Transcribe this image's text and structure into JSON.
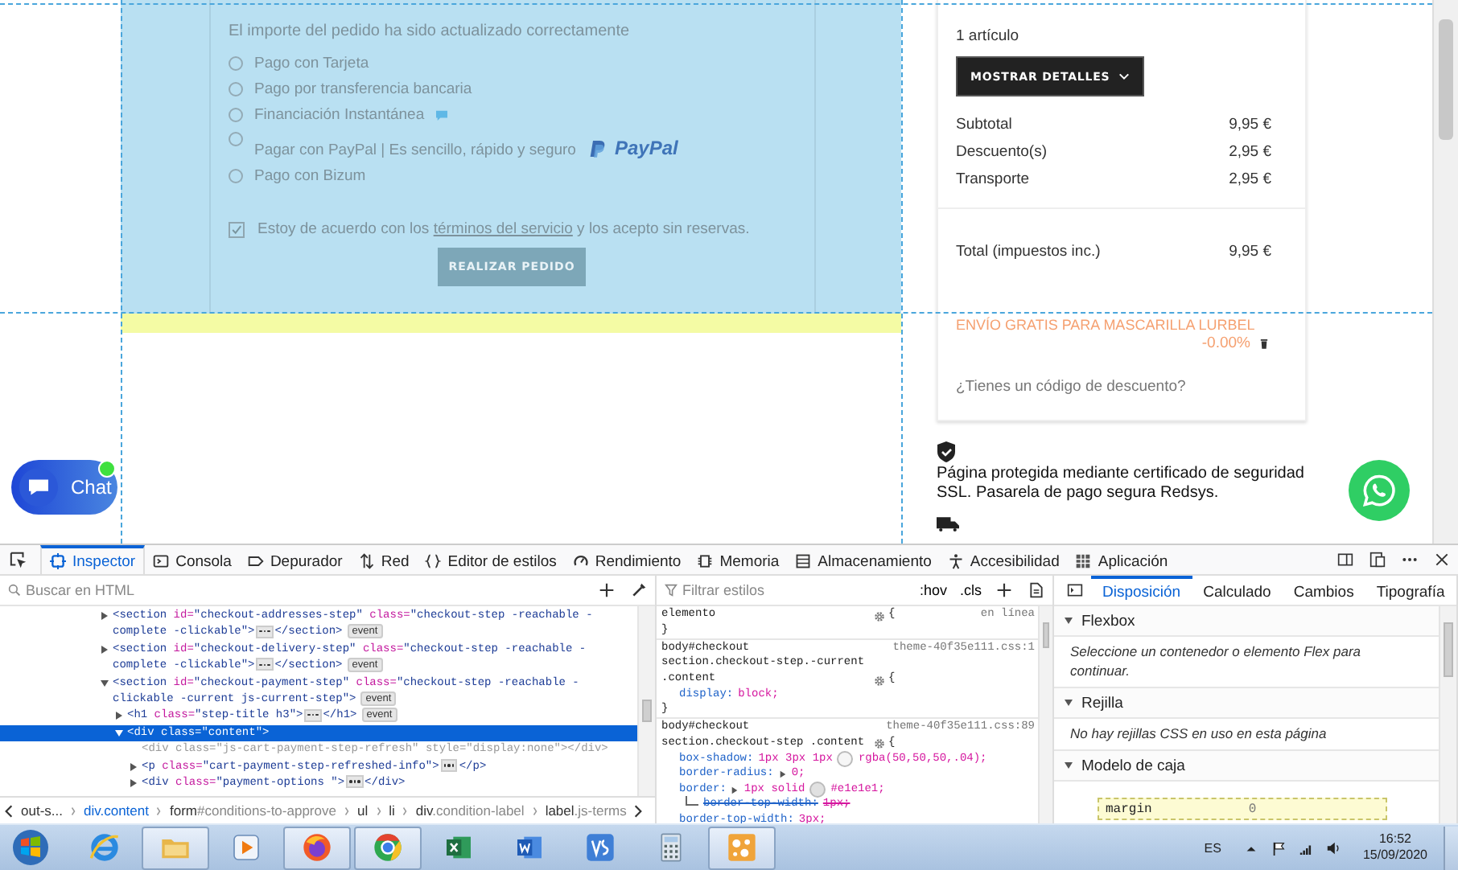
{
  "page": {
    "notice": "El importe del pedido ha sido actualizado correctamente",
    "payment_options": [
      {
        "label": "Pago con Tarjeta",
        "selected": false,
        "kind": "plain"
      },
      {
        "label": "Pago por transferencia bancaria",
        "selected": false,
        "kind": "plain"
      },
      {
        "label": "Financiación Instantánea",
        "selected": false,
        "kind": "info"
      },
      {
        "label": "Pagar con PayPal | Es sencillo, rápido y seguro",
        "selected": false,
        "kind": "logo",
        "logo": "PayPal"
      },
      {
        "label": "Pago con Bizum",
        "selected": false,
        "kind": "plain"
      }
    ],
    "terms": {
      "checked": true,
      "before": "Estoy de acuerdo con los ",
      "link": "términos del servicio",
      "after": " y los acepto sin reservas."
    },
    "order_button": "REALIZAR PEDIDO",
    "chat": {
      "label": "Chat",
      "online": true
    }
  },
  "order_summary": {
    "item_count": "1 artículo",
    "details_button": "MOSTRAR DETALLES",
    "lines": [
      {
        "label": "Subtotal",
        "value": "9,95 €"
      },
      {
        "label": "Descuento(s)",
        "value": "2,95 €"
      },
      {
        "label": "Transporte",
        "value": "2,95 €"
      }
    ],
    "total": {
      "label": "Total (impuestos inc.)",
      "value": "9,95 €"
    },
    "promo": {
      "name": "ENVÍO GRATIS PARA MASCARILLA LURBEL",
      "value": "-0.00%"
    },
    "discount_prompt": "¿Tienes un código de descuento?",
    "security_note": "Página protegida mediante certificado de seguridad SSL. Pasarela de pago segura Redsys."
  },
  "devtools": {
    "tabs": [
      {
        "label": "Inspector",
        "kind": "inspector",
        "selected": true
      },
      {
        "label": "Consola",
        "kind": "console",
        "selected": false
      },
      {
        "label": "Depurador",
        "kind": "debugger",
        "selected": false
      },
      {
        "label": "Red",
        "kind": "network",
        "selected": false
      },
      {
        "label": "Editor de estilos",
        "kind": "style",
        "selected": false
      },
      {
        "label": "Rendimiento",
        "kind": "performance",
        "selected": false
      },
      {
        "label": "Memoria",
        "kind": "memory",
        "selected": false
      },
      {
        "label": "Almacenamiento",
        "kind": "storage",
        "selected": false
      },
      {
        "label": "Accesibilidad",
        "kind": "accessibility",
        "selected": false
      },
      {
        "label": "Aplicación",
        "kind": "application",
        "selected": false
      }
    ],
    "search_placeholder": "Buscar en HTML",
    "tree": [
      {
        "selected": false,
        "expanded": false,
        "parts": [
          {
            "kind": "tag",
            "text": "<section"
          },
          {
            "kind": "attr",
            "text": " id="
          },
          {
            "kind": "value",
            "text": "\"checkout-addresses-step\""
          },
          {
            "kind": "attr",
            "text": " class="
          },
          {
            "kind": "value",
            "text": "\"checkout-step -reachable -complete -clickable\""
          },
          {
            "kind": "tag",
            "text": ">"
          },
          {
            "kind": "more"
          },
          {
            "kind": "tag",
            "text": "</section>"
          },
          {
            "kind": "badge",
            "text": "event"
          }
        ]
      },
      {
        "selected": false,
        "expanded": false,
        "parts": [
          {
            "kind": "tag",
            "text": "<section"
          },
          {
            "kind": "attr",
            "text": " id="
          },
          {
            "kind": "value",
            "text": "\"checkout-delivery-step\""
          },
          {
            "kind": "attr",
            "text": " class="
          },
          {
            "kind": "value",
            "text": "\"checkout-step -reachable -complete -clickable\""
          },
          {
            "kind": "tag",
            "text": ">"
          },
          {
            "kind": "more"
          },
          {
            "kind": "tag",
            "text": "</section>"
          },
          {
            "kind": "badge",
            "text": "event"
          }
        ]
      },
      {
        "selected": false,
        "expanded": true,
        "parts": [
          {
            "kind": "tag",
            "text": "<section"
          },
          {
            "kind": "attr",
            "text": " id="
          },
          {
            "kind": "value",
            "text": "\"checkout-payment-step\""
          },
          {
            "kind": "attr",
            "text": " class="
          },
          {
            "kind": "value",
            "text": "\"checkout-step -reachable -clickable -current js-current-step\""
          },
          {
            "kind": "tag",
            "text": ">"
          },
          {
            "kind": "badge",
            "text": "event"
          }
        ],
        "children": [
          {
            "selected": false,
            "expanded": false,
            "parts": [
              {
                "kind": "tag",
                "text": "<h1"
              },
              {
                "kind": "attr",
                "text": " class="
              },
              {
                "kind": "value",
                "text": "\"step-title h3\""
              },
              {
                "kind": "tag",
                "text": ">"
              },
              {
                "kind": "more"
              },
              {
                "kind": "tag",
                "text": "</h1>"
              },
              {
                "kind": "badge",
                "text": "event"
              }
            ]
          },
          {
            "selected": true,
            "expanded": true,
            "parts": [
              {
                "kind": "tag",
                "text": "<div"
              },
              {
                "kind": "attr",
                "text": " class="
              },
              {
                "kind": "value",
                "text": "\"content\""
              },
              {
                "kind": "tag",
                "text": ">"
              }
            ],
            "children": [
              {
                "selected": false,
                "hidden": true,
                "parts": [
                  {
                    "kind": "tag",
                    "text": "<div"
                  },
                  {
                    "kind": "attr",
                    "text": " class="
                  },
                  {
                    "kind": "value",
                    "text": "\"js-cart-payment-step-refresh\""
                  },
                  {
                    "kind": "attr",
                    "text": " style="
                  },
                  {
                    "kind": "value",
                    "text": "\"display:none\""
                  },
                  {
                    "kind": "tag",
                    "text": "></div>"
                  }
                ]
              },
              {
                "selected": false,
                "expanded": false,
                "parts": [
                  {
                    "kind": "tag",
                    "text": "<p"
                  },
                  {
                    "kind": "attr",
                    "text": " class="
                  },
                  {
                    "kind": "value",
                    "text": "\"cart-payment-step-refreshed-info\""
                  },
                  {
                    "kind": "tag",
                    "text": ">"
                  },
                  {
                    "kind": "more"
                  },
                  {
                    "kind": "tag",
                    "text": "</p>"
                  }
                ]
              },
              {
                "selected": false,
                "expanded": false,
                "parts": [
                  {
                    "kind": "tag",
                    "text": "<div"
                  },
                  {
                    "kind": "attr",
                    "text": " class="
                  },
                  {
                    "kind": "value",
                    "text": "\"payment-options \""
                  },
                  {
                    "kind": "tag",
                    "text": ">"
                  },
                  {
                    "kind": "more"
                  },
                  {
                    "kind": "tag",
                    "text": "</div>"
                  }
                ]
              }
            ]
          }
        ]
      }
    ],
    "breadcrumb": [
      {
        "tag": "out-s...",
        "selected": false
      },
      {
        "tag": "div",
        "rest": ".content",
        "selected": true
      },
      {
        "tag": "form",
        "rest": "#conditions-to-approve",
        "selected": false
      },
      {
        "tag": "ul",
        "selected": false
      },
      {
        "tag": "li",
        "selected": false
      },
      {
        "tag": "div",
        "rest": ".condition-label",
        "selected": false
      },
      {
        "tag": "label",
        "rest": ".js-terms",
        "selected": false
      }
    ],
    "styles": {
      "filter_placeholder": "Filtrar estilos",
      "hov": ":hov",
      "cls": ".cls",
      "rules": [
        {
          "selector": "elemento",
          "source": "en línea",
          "open": "{",
          "close": "}"
        },
        {
          "selector": "body#checkout section.checkout-step.-current .content",
          "source": "theme-40f35e111.css:1",
          "open": "{",
          "close": "}",
          "declarations": [
            {
              "property": "display:",
              "value": "block;",
              "overridden": false,
              "kind": "plain"
            }
          ]
        },
        {
          "selector": "body#checkout section.checkout-step .content",
          "source": "theme-40f35e111.css:89",
          "open": "{",
          "declarations": [
            {
              "property": "box-shadow:",
              "value": "1px 3px 1px",
              "color_value": "rgba(50,50,50,.04);",
              "color": "#f6f6f6",
              "overridden": false,
              "kind": "color"
            },
            {
              "property": "border-radius:",
              "value": "0;",
              "overridden": false,
              "kind": "expand"
            },
            {
              "property": "border:",
              "value": "1px solid",
              "color_value": "#e1e1e1;",
              "color": "#e1e1e1",
              "overridden": false,
              "kind": "expand-color"
            },
            {
              "property": "border-top-width:",
              "value": "1px;",
              "overridden": true,
              "kind": "sub"
            },
            {
              "property": "border-top-width:",
              "value": "3px;",
              "overridden": false,
              "kind": "plain"
            }
          ]
        }
      ]
    },
    "layout": {
      "tabs": [
        {
          "label": "Disposición",
          "selected": true
        },
        {
          "label": "Calculado",
          "selected": false
        },
        {
          "label": "Cambios",
          "selected": false
        },
        {
          "label": "Tipografía",
          "selected": false
        }
      ],
      "sections": [
        {
          "title": "Flexbox",
          "expanded": true,
          "message": "Seleccione un contenedor o elemento Flex para continuar."
        },
        {
          "title": "Rejilla",
          "expanded": true,
          "message": "No hay rejillas CSS en uso en esta página"
        },
        {
          "title": "Modelo de caja",
          "expanded": true
        }
      ],
      "box_model": {
        "label": "margin",
        "value": "0"
      }
    }
  },
  "taskbar": {
    "apps": [
      {
        "kind": "ie",
        "active": false
      },
      {
        "kind": "folder",
        "active": true
      },
      {
        "kind": "media",
        "active": false
      },
      {
        "kind": "firefox",
        "active": true
      },
      {
        "kind": "chrome",
        "active": true
      },
      {
        "kind": "excel",
        "active": false
      },
      {
        "kind": "word",
        "active": false
      },
      {
        "kind": "vs",
        "active": false
      },
      {
        "kind": "calculator",
        "active": false
      },
      {
        "kind": "dots",
        "active": true
      }
    ],
    "language": "ES",
    "time": "16:52",
    "date": "15/09/2020"
  }
}
